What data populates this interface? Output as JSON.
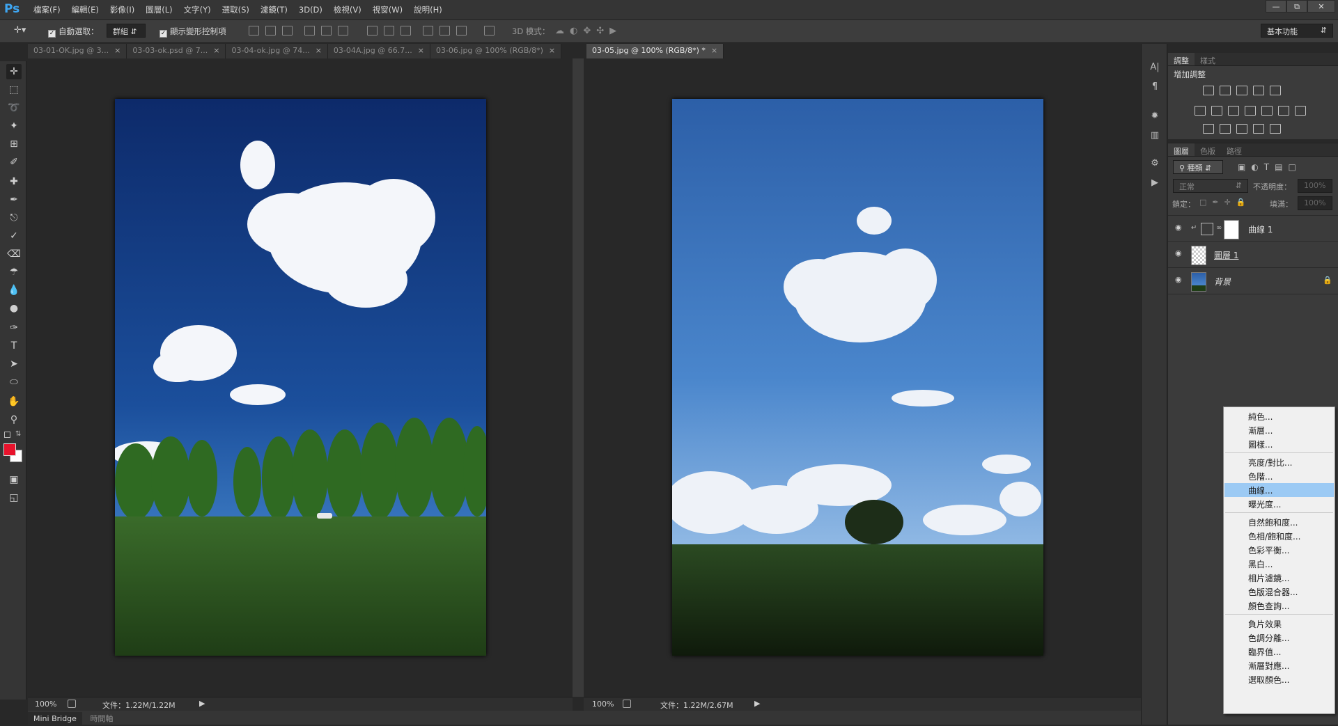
{
  "app": {
    "logo": "Ps"
  },
  "menubar": {
    "items": [
      "檔案(F)",
      "編輯(E)",
      "影像(I)",
      "圖層(L)",
      "文字(Y)",
      "選取(S)",
      "濾鏡(T)",
      "3D(D)",
      "檢視(V)",
      "視窗(W)",
      "說明(H)"
    ]
  },
  "window_controls": {
    "minimize": "—",
    "restore": "⧉",
    "close": "✕"
  },
  "options": {
    "auto_select_label": "自動選取：",
    "auto_select_value": "群組",
    "show_transform_label": "顯示變形控制項",
    "mode_3d_label": "3D 模式：",
    "workspace": "基本功能"
  },
  "tabs": {
    "left": [
      {
        "label": "03-01-OK.jpg @ 3...",
        "close": "×"
      },
      {
        "label": "03-03-ok.psd @ 7...",
        "close": "×"
      },
      {
        "label": "03-04-ok.jpg @ 74...",
        "close": "×"
      },
      {
        "label": "03-04A.jpg @ 66.7...",
        "close": "×"
      },
      {
        "label": "03-06.jpg @ 100% (RGB/8*)",
        "close": "×"
      }
    ],
    "right": [
      {
        "label": "03-05.jpg @ 100% (RGB/8*) *",
        "close": "×"
      }
    ]
  },
  "status": {
    "left": {
      "zoom": "100%",
      "doc": "文件：1.22M/1.22M"
    },
    "right": {
      "zoom": "100%",
      "doc": "文件：1.22M/2.67M"
    }
  },
  "bottom_tabs": [
    "Mini Bridge",
    "時間軸"
  ],
  "adjust_panel": {
    "tabs": [
      "調整",
      "樣式"
    ],
    "title": "增加調整"
  },
  "layers_panel": {
    "tabs": [
      "圖層",
      "色版",
      "路徑"
    ],
    "filter": "種類",
    "blend_mode": "正常",
    "opacity_label": "不透明度：",
    "opacity_value": "100%",
    "lock_label": "鎖定：",
    "fill_label": "填滿：",
    "fill_value": "100%",
    "layers": [
      {
        "name": "曲線 1",
        "type": "adjustment"
      },
      {
        "name": "圖層 1",
        "type": "pixel"
      },
      {
        "name": "背景",
        "type": "background"
      }
    ]
  },
  "context_menu": {
    "groups": [
      [
        "純色...",
        "漸層...",
        "圖樣..."
      ],
      [
        "亮度/對比...",
        "色階...",
        "曲線...",
        "曝光度..."
      ],
      [
        "自然飽和度...",
        "色相/飽和度...",
        "色彩平衡...",
        "黑白...",
        "相片濾鏡...",
        "色版混合器...",
        "顏色查詢..."
      ],
      [
        "負片效果",
        "色調分離...",
        "臨界值...",
        "漸層對應...",
        "選取顏色..."
      ]
    ],
    "highlighted": "曲線..."
  },
  "colors": {
    "foreground": "#e8132c",
    "background": "#ffffff",
    "highlight": "#9ccaf4"
  }
}
